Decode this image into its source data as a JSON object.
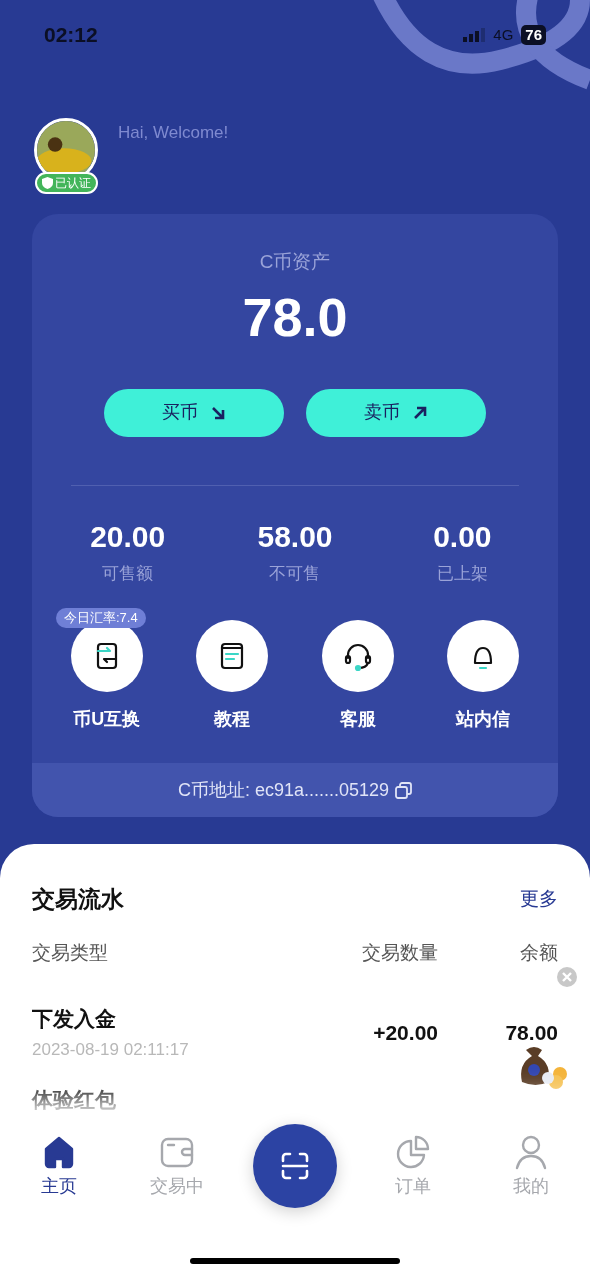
{
  "status_bar": {
    "time": "02:12",
    "network": "4G",
    "battery": "76"
  },
  "user": {
    "greeting": "Hai, Welcome!",
    "badge": "已认证"
  },
  "assets": {
    "label": "C币资产",
    "value": "78.0",
    "buttons": [
      {
        "label": "买币",
        "kind": "buy"
      },
      {
        "label": "卖币",
        "kind": "sell"
      }
    ],
    "stats": [
      {
        "value": "20.00",
        "label": "可售额"
      },
      {
        "value": "58.00",
        "label": "不可售"
      },
      {
        "value": "0.00",
        "label": "已上架"
      }
    ],
    "actions": [
      {
        "label": "币U互换",
        "kind": "swap",
        "badge": "今日汇率:7.4"
      },
      {
        "label": "教程",
        "kind": "book"
      },
      {
        "label": "客服",
        "kind": "headset"
      },
      {
        "label": "站内信",
        "kind": "bell"
      }
    ],
    "address": "C币地址: ec91a.......05129"
  },
  "transactions": {
    "title": "交易流水",
    "more": "更多",
    "columns": [
      "交易类型",
      "交易数量",
      "余额"
    ],
    "rows": [
      {
        "type": "下发入金",
        "time": "2023-08-19 02:11:17",
        "amount": "+20.00",
        "balance": "78.00"
      },
      {
        "type": "体验红包"
      }
    ]
  },
  "nav": {
    "items": [
      {
        "label": "主页",
        "kind": "home",
        "selected": true
      },
      {
        "label": "交易中",
        "kind": "wallet",
        "selected": false
      },
      {
        "kind": "scan"
      },
      {
        "label": "订单",
        "kind": "chart",
        "selected": false
      },
      {
        "label": "我的",
        "kind": "user",
        "selected": false
      }
    ]
  }
}
